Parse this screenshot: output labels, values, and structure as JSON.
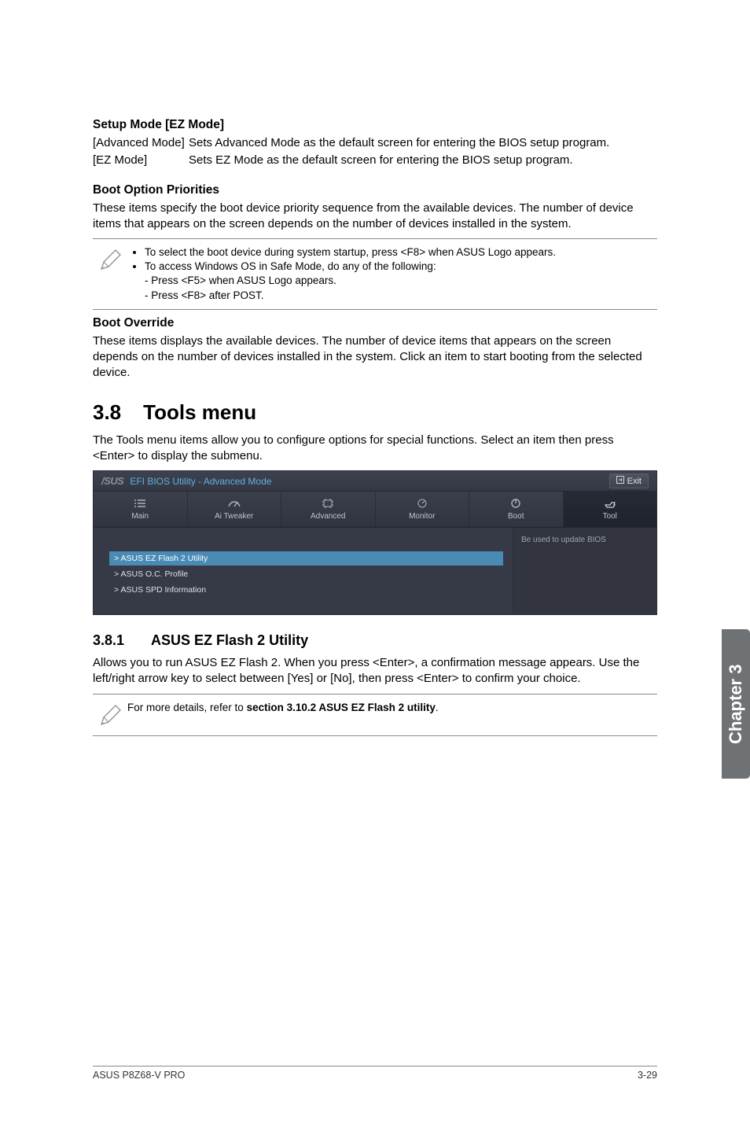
{
  "section_setup_mode": {
    "heading": "Setup Mode [EZ Mode]",
    "rows": [
      {
        "term": "[Advanced Mode]",
        "def": "Sets Advanced Mode as the default screen for entering the BIOS setup program."
      },
      {
        "term": "[EZ Mode]",
        "def": "Sets EZ Mode as the default screen for entering the BIOS setup program."
      }
    ]
  },
  "section_boot_priorities": {
    "heading": "Boot Option Priorities",
    "para": "These items specify the boot device priority sequence from the available devices. The number of device items that appears on the screen depends on the number of devices installed in the system."
  },
  "note1": {
    "bullets": [
      "To select the boot device during system startup, press <F8> when ASUS Logo appears.",
      "To access Windows OS in Safe Mode, do any of the following:"
    ],
    "subs": [
      "- Press <F5> when ASUS Logo appears.",
      "- Press <F8> after POST."
    ]
  },
  "section_boot_override": {
    "heading": "Boot Override",
    "para": "These items displays the available devices. The number of device items that appears on the screen depends on the number of devices installed in the system. Click an item to start booting from the selected device."
  },
  "tools_section": {
    "num": "3.8",
    "title": "Tools menu",
    "para": "The Tools menu items allow you to configure options for special functions. Select an item then press <Enter> to display the submenu."
  },
  "bios": {
    "logo": "/SUS",
    "title": "EFI BIOS Utility - Advanced Mode",
    "exit_label": "Exit",
    "tabs": [
      {
        "label": "Main"
      },
      {
        "label": "Ai  Tweaker"
      },
      {
        "label": "Advanced"
      },
      {
        "label": "Monitor"
      },
      {
        "label": "Boot"
      },
      {
        "label": "Tool"
      }
    ],
    "items": [
      "ASUS EZ Flash 2 Utility",
      "ASUS O.C. Profile",
      "ASUS SPD Information"
    ],
    "help_text": "Be used to update BIOS"
  },
  "ez_flash": {
    "num": "3.8.1",
    "title": "ASUS EZ Flash 2 Utility",
    "para": "Allows you to run ASUS EZ Flash 2. When you press <Enter>, a confirmation message appears. Use the left/right arrow key to select between [Yes] or [No], then press <Enter> to confirm your choice."
  },
  "note2": {
    "prefix": "For more details, refer to ",
    "bold": "section 3.10.2 ASUS EZ Flash 2 utility",
    "suffix": "."
  },
  "side_tab": "Chapter 3",
  "footer": {
    "left": "ASUS P8Z68-V PRO",
    "right": "3-29"
  }
}
